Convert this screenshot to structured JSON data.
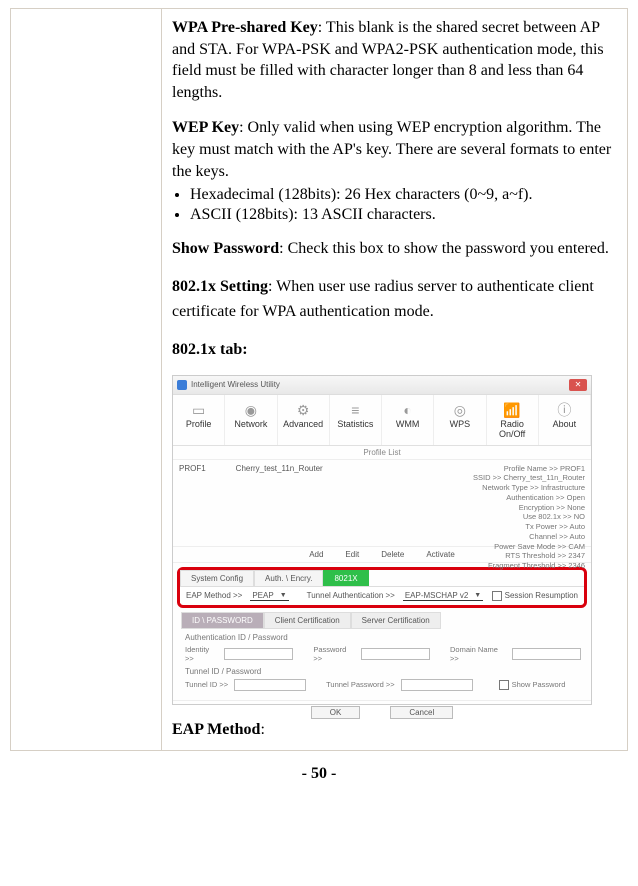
{
  "doc": {
    "wpa_psk_label": "WPA Pre-shared Key",
    "wpa_psk_text": ": This blank is the shared secret between AP and STA. For WPA-PSK and WPA2-PSK authentication mode, this field must be filled with character longer than 8 and less than 64 lengths.",
    "wep_label": "WEP Key",
    "wep_text": ": Only valid when using WEP encryption algorithm. The key must match with the AP's key. There are several formats to enter the keys.",
    "bullet_hex": "Hexadecimal (128bits): 26 Hex characters (0~9, a~f).",
    "bullet_ascii": "ASCII (128bits): 13 ASCII characters.",
    "show_pw_label": "Show Password",
    "show_pw_text": ": Check this box to show the password you entered.",
    "x8021_label": "802.1x Setting",
    "x8021_text": ": When user use radius server to authenticate client certificate for WPA authentication mode.",
    "tab_heading": "802.1x tab:",
    "eap_method_label": "EAP Method",
    "eap_method_colon": ":",
    "page_num": "- 50 -"
  },
  "shot": {
    "window_title": "Intelligent Wireless Utility",
    "close": "✕",
    "tabs": [
      "Profile",
      "Network",
      "Advanced",
      "Statistics",
      "WMM",
      "WPS",
      "Radio On/Off",
      "About"
    ],
    "section_profile_list": "Profile List",
    "profile_name": "PROF1",
    "profile_ssid": "Cherry_test_11n_Router",
    "details": {
      "l1": "Profile Name >>  PROF1",
      "l2": "SSID >>  Cherry_test_11n_Router",
      "l3": "Network Type >>  Infrastructure",
      "l4": "Authentication >>  Open",
      "l5": "Encryption >>  None",
      "l6": "Use 802.1x >>  NO",
      "l7": "Tx Power >>  Auto",
      "l8": "Channel >>  Auto",
      "l9": "Power Save Mode >>  CAM",
      "l10": "RTS Threshold >>  2347",
      "l11": "Fragment Threshold >>  2346"
    },
    "profbtns": {
      "add": "Add",
      "edit": "Edit",
      "delete": "Delete",
      "activate": "Activate"
    },
    "subtabs": {
      "sys": "System Config",
      "auth": "Auth. \\ Encry.",
      "x8021": "8021X"
    },
    "eap": {
      "label": "EAP Method >>",
      "value": "PEAP",
      "tunnel_label": "Tunnel Authentication >>",
      "tunnel_value": "EAP-MSCHAP v2",
      "session": "Session Resumption"
    },
    "idtabs": {
      "idpw": "ID \\ PASSWORD",
      "client": "Client Certification",
      "server": "Server Certification"
    },
    "form": {
      "sec1": "Authentication ID / Password",
      "identity": "Identity >>",
      "password": "Password >>",
      "domain": "Domain Name >>",
      "sec2": "Tunnel ID / Password",
      "tunnel_id": "Tunnel ID >>",
      "tunnel_pw": "Tunnel Password >>",
      "show_pw": "Show Password"
    },
    "ok": "OK",
    "cancel": "Cancel"
  }
}
